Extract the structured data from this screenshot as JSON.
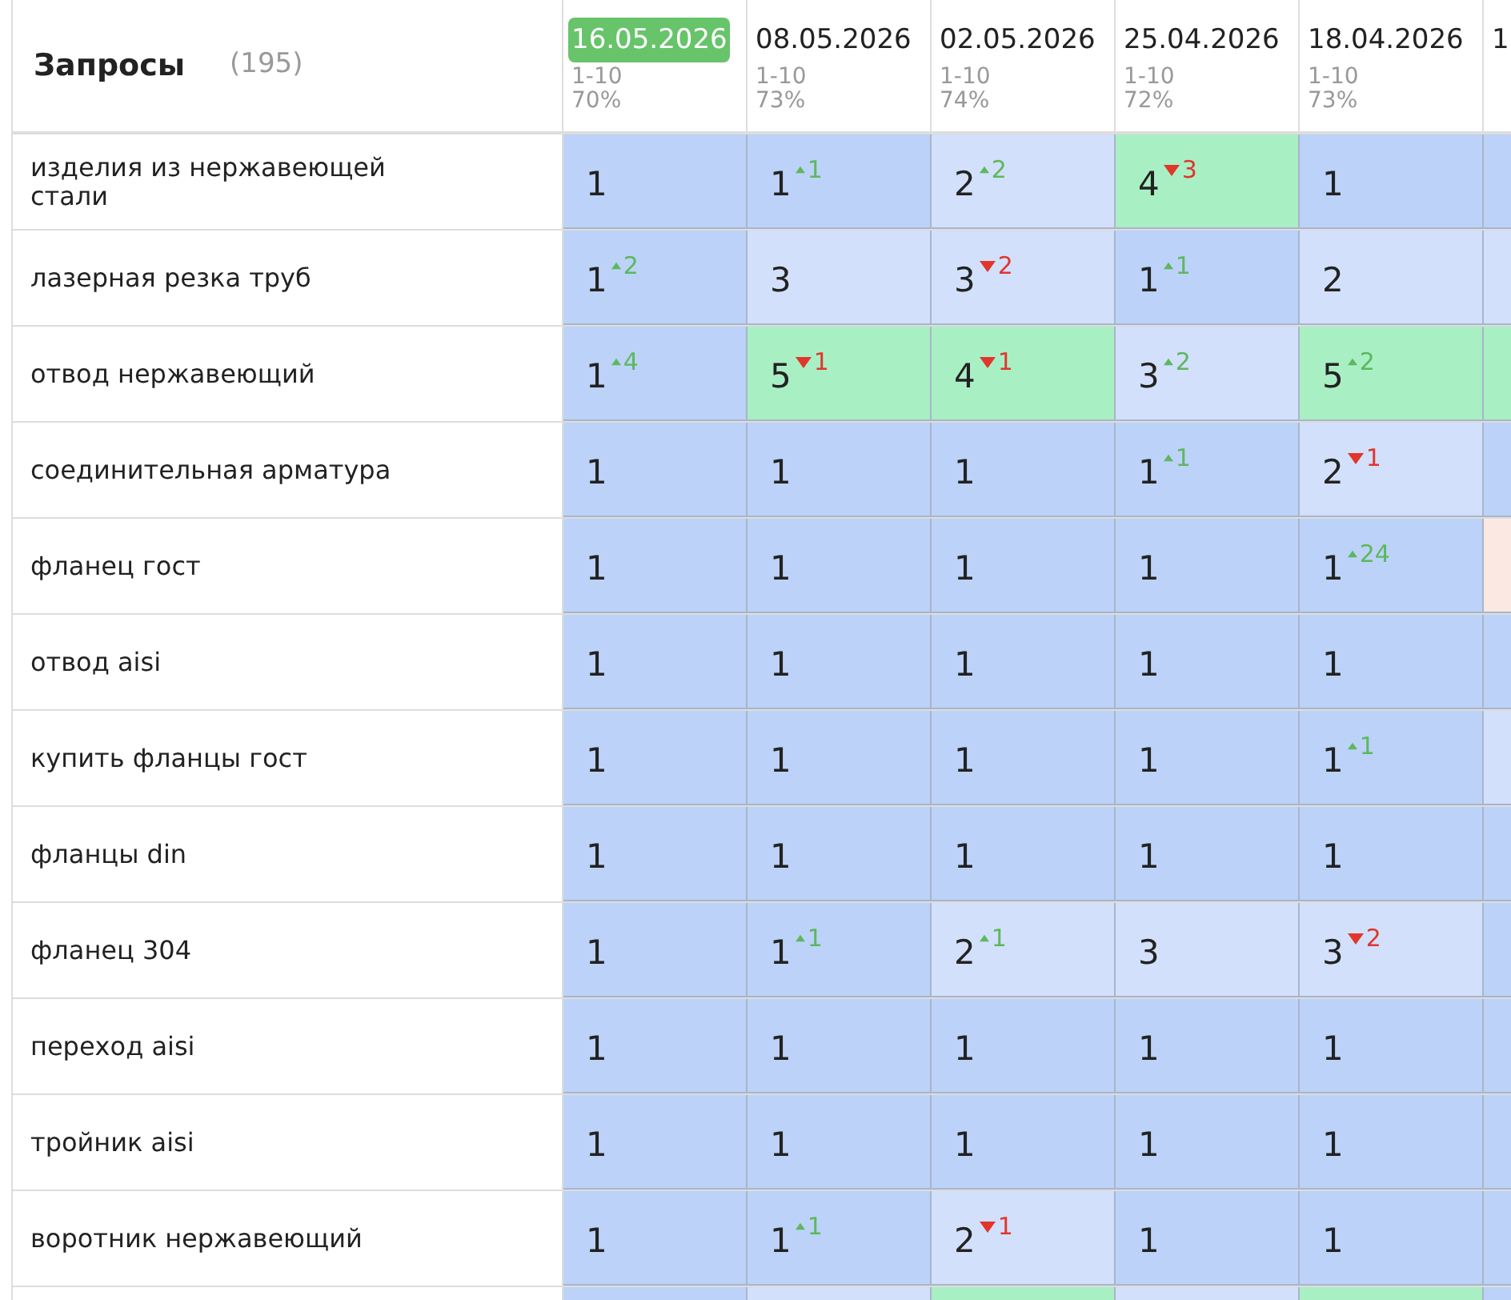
{
  "header": {
    "title": "Запросы",
    "count": "(195)"
  },
  "columns": [
    {
      "date": "16.05.2026",
      "selected": true,
      "range": "1-10",
      "percent": "70%"
    },
    {
      "date": "08.05.2026",
      "selected": false,
      "range": "1-10",
      "percent": "73%"
    },
    {
      "date": "02.05.2026",
      "selected": false,
      "range": "1-10",
      "percent": "74%"
    },
    {
      "date": "25.04.2026",
      "selected": false,
      "range": "1-10",
      "percent": "72%"
    },
    {
      "date": "18.04.2026",
      "selected": false,
      "range": "1-10",
      "percent": "73%"
    },
    {
      "date": "1",
      "selected": false
    }
  ],
  "rows": [
    {
      "query": "изделия из нержавеющей стали",
      "cells": [
        {
          "value": "1",
          "color": "#bcd2f8"
        },
        {
          "value": "1",
          "color": "#bcd2f8",
          "change": {
            "kind": "up",
            "amount": "1"
          }
        },
        {
          "value": "2",
          "color": "#d2e0fb",
          "change": {
            "kind": "up",
            "amount": "2"
          }
        },
        {
          "value": "4",
          "color": "#a9efc4",
          "change": {
            "kind": "down",
            "amount": "3"
          }
        },
        {
          "value": "1",
          "color": "#bcd2f8"
        },
        {
          "color": "#bcd2f8"
        }
      ]
    },
    {
      "query": "лазерная резка труб",
      "cells": [
        {
          "value": "1",
          "color": "#bcd2f8",
          "change": {
            "kind": "up",
            "amount": "2"
          }
        },
        {
          "value": "3",
          "color": "#d2e0fb"
        },
        {
          "value": "3",
          "color": "#d2e0fb",
          "change": {
            "kind": "down",
            "amount": "2"
          }
        },
        {
          "value": "1",
          "color": "#bcd2f8",
          "change": {
            "kind": "up",
            "amount": "1"
          }
        },
        {
          "value": "2",
          "color": "#d2e0fb"
        },
        {
          "color": "#d2e0fb"
        }
      ]
    },
    {
      "query": "отвод нержавеющий",
      "cells": [
        {
          "value": "1",
          "color": "#bcd2f8",
          "change": {
            "kind": "up",
            "amount": "4"
          }
        },
        {
          "value": "5",
          "color": "#a9efc4",
          "change": {
            "kind": "down",
            "amount": "1"
          }
        },
        {
          "value": "4",
          "color": "#a9efc4",
          "change": {
            "kind": "down",
            "amount": "1"
          }
        },
        {
          "value": "3",
          "color": "#d2e0fb",
          "change": {
            "kind": "up",
            "amount": "2"
          }
        },
        {
          "value": "5",
          "color": "#a9efc4",
          "change": {
            "kind": "up",
            "amount": "2"
          }
        },
        {
          "color": "#a9efc4"
        }
      ]
    },
    {
      "query": "соединительная арматура",
      "cells": [
        {
          "value": "1",
          "color": "#bcd2f8"
        },
        {
          "value": "1",
          "color": "#bcd2f8"
        },
        {
          "value": "1",
          "color": "#bcd2f8"
        },
        {
          "value": "1",
          "color": "#bcd2f8",
          "change": {
            "kind": "up",
            "amount": "1"
          }
        },
        {
          "value": "2",
          "color": "#d2e0fb",
          "change": {
            "kind": "down",
            "amount": "1"
          }
        },
        {
          "color": "#bcd2f8"
        }
      ]
    },
    {
      "query": "фланец гост",
      "cells": [
        {
          "value": "1",
          "color": "#bcd2f8"
        },
        {
          "value": "1",
          "color": "#bcd2f8"
        },
        {
          "value": "1",
          "color": "#bcd2f8"
        },
        {
          "value": "1",
          "color": "#bcd2f8"
        },
        {
          "value": "1",
          "color": "#bcd2f8",
          "change": {
            "kind": "up",
            "amount": "24"
          }
        },
        {
          "color": "#fbe8e2"
        }
      ]
    },
    {
      "query": "отвод aisi",
      "cells": [
        {
          "value": "1",
          "color": "#bcd2f8"
        },
        {
          "value": "1",
          "color": "#bcd2f8"
        },
        {
          "value": "1",
          "color": "#bcd2f8"
        },
        {
          "value": "1",
          "color": "#bcd2f8"
        },
        {
          "value": "1",
          "color": "#bcd2f8"
        },
        {
          "color": "#bcd2f8"
        }
      ]
    },
    {
      "query": "купить фланцы гост",
      "cells": [
        {
          "value": "1",
          "color": "#bcd2f8"
        },
        {
          "value": "1",
          "color": "#bcd2f8"
        },
        {
          "value": "1",
          "color": "#bcd2f8"
        },
        {
          "value": "1",
          "color": "#bcd2f8"
        },
        {
          "value": "1",
          "color": "#bcd2f8",
          "change": {
            "kind": "up",
            "amount": "1"
          }
        },
        {
          "color": "#d2e0fb"
        }
      ]
    },
    {
      "query": "фланцы din",
      "cells": [
        {
          "value": "1",
          "color": "#bcd2f8"
        },
        {
          "value": "1",
          "color": "#bcd2f8"
        },
        {
          "value": "1",
          "color": "#bcd2f8"
        },
        {
          "value": "1",
          "color": "#bcd2f8"
        },
        {
          "value": "1",
          "color": "#bcd2f8"
        },
        {
          "color": "#bcd2f8"
        }
      ]
    },
    {
      "query": "фланец 304",
      "cells": [
        {
          "value": "1",
          "color": "#bcd2f8"
        },
        {
          "value": "1",
          "color": "#bcd2f8",
          "change": {
            "kind": "up",
            "amount": "1"
          }
        },
        {
          "value": "2",
          "color": "#d2e0fb",
          "change": {
            "kind": "up",
            "amount": "1"
          }
        },
        {
          "value": "3",
          "color": "#d2e0fb"
        },
        {
          "value": "3",
          "color": "#d2e0fb",
          "change": {
            "kind": "down",
            "amount": "2"
          }
        },
        {
          "color": "#bcd2f8"
        }
      ]
    },
    {
      "query": "переход aisi",
      "cells": [
        {
          "value": "1",
          "color": "#bcd2f8"
        },
        {
          "value": "1",
          "color": "#bcd2f8"
        },
        {
          "value": "1",
          "color": "#bcd2f8"
        },
        {
          "value": "1",
          "color": "#bcd2f8"
        },
        {
          "value": "1",
          "color": "#bcd2f8"
        },
        {
          "color": "#bcd2f8"
        }
      ]
    },
    {
      "query": "тройник aisi",
      "cells": [
        {
          "value": "1",
          "color": "#bcd2f8"
        },
        {
          "value": "1",
          "color": "#bcd2f8"
        },
        {
          "value": "1",
          "color": "#bcd2f8"
        },
        {
          "value": "1",
          "color": "#bcd2f8"
        },
        {
          "value": "1",
          "color": "#bcd2f8"
        },
        {
          "color": "#bcd2f8"
        }
      ]
    },
    {
      "query": "воротник нержавеющий",
      "cells": [
        {
          "value": "1",
          "color": "#bcd2f8"
        },
        {
          "value": "1",
          "color": "#bcd2f8",
          "change": {
            "kind": "up",
            "amount": "1"
          }
        },
        {
          "value": "2",
          "color": "#d2e0fb",
          "change": {
            "kind": "down",
            "amount": "1"
          }
        },
        {
          "value": "1",
          "color": "#bcd2f8"
        },
        {
          "value": "1",
          "color": "#bcd2f8"
        },
        {
          "color": "#bcd2f8"
        }
      ]
    },
    {
      "cells": [
        {
          "color": "#bcd2f8"
        },
        {
          "color": "#d2e0fb"
        },
        {
          "color": "#a9efc4"
        },
        {
          "color": "#d2e0fb"
        },
        {
          "color": "#a9efc4"
        },
        {
          "color": "#bcd2f8"
        }
      ]
    }
  ]
}
